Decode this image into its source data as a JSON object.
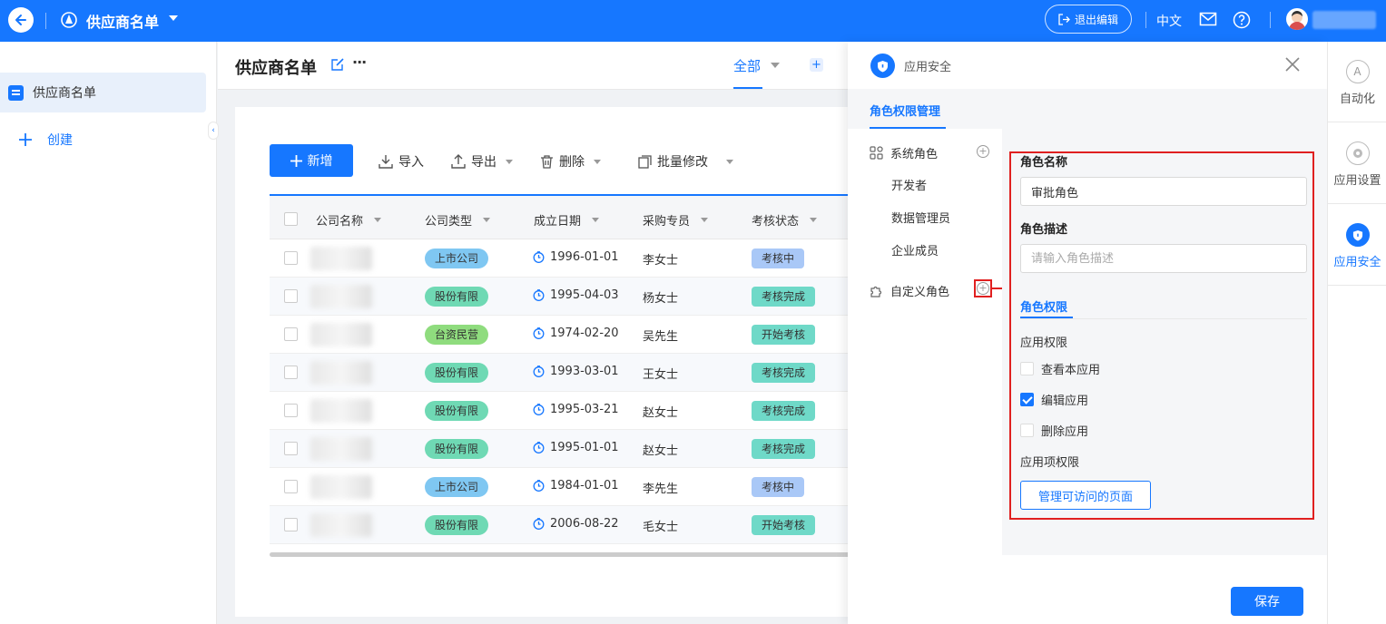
{
  "topbar": {
    "app_title": "供应商名单",
    "exit_edit": "退出编辑",
    "language": "中文"
  },
  "sidebar": {
    "items": [
      {
        "label": "供应商名单"
      }
    ],
    "create_label": "创建"
  },
  "main": {
    "page_title": "供应商名单",
    "view_tab": "全部",
    "toolbar": {
      "add": "新增",
      "import": "导入",
      "export": "导出",
      "delete": "删除",
      "batch_edit": "批量修改"
    },
    "table": {
      "columns": [
        "公司名称",
        "公司类型",
        "成立日期",
        "采购专员",
        "考核状态"
      ],
      "rows": [
        {
          "type": "上市公司",
          "date": "1996-01-01",
          "person": "李女士",
          "status": "考核中"
        },
        {
          "type": "股份有限",
          "date": "1995-04-03",
          "person": "杨女士",
          "status": "考核完成"
        },
        {
          "type": "台资民营",
          "date": "1974-02-20",
          "person": "吴先生",
          "status": "开始考核"
        },
        {
          "type": "股份有限",
          "date": "1993-03-01",
          "person": "王女士",
          "status": "考核完成"
        },
        {
          "type": "股份有限",
          "date": "1995-03-21",
          "person": "赵女士",
          "status": "考核完成"
        },
        {
          "type": "股份有限",
          "date": "1995-01-01",
          "person": "赵女士",
          "status": "考核完成"
        },
        {
          "type": "上市公司",
          "date": "1984-01-01",
          "person": "李先生",
          "status": "考核中"
        },
        {
          "type": "股份有限",
          "date": "2006-08-22",
          "person": "毛女士",
          "status": "开始考核"
        }
      ]
    }
  },
  "drawer": {
    "title": "应用安全",
    "tab": "角色权限管理",
    "system_roles_label": "系统角色",
    "system_roles": [
      "开发者",
      "数据管理员",
      "企业成员"
    ],
    "custom_roles_label": "自定义角色",
    "form": {
      "role_name_label": "角色名称",
      "role_name_value": "审批角色",
      "role_desc_label": "角色描述",
      "role_desc_placeholder": "请输入角色描述",
      "perm_tab": "角色权限",
      "app_perm_label": "应用权限",
      "perms": [
        {
          "label": "查看本应用",
          "checked": false
        },
        {
          "label": "编辑应用",
          "checked": true
        },
        {
          "label": "删除应用",
          "checked": false
        }
      ],
      "item_perm_label": "应用项权限",
      "manage_pages_button": "管理可访问的页面"
    },
    "save_button": "保存"
  },
  "rail": {
    "items": [
      {
        "label": "自动化"
      },
      {
        "label": "应用设置"
      },
      {
        "label": "应用安全"
      }
    ]
  },
  "colors": {
    "primary": "#1677ff",
    "highlight_red": "#e02020",
    "tag_blue": "#7fc7f2",
    "tag_green": "#6fd9b4",
    "tag_lime": "#8fdc7e",
    "status_blue": "#a9c8f7",
    "status_teal": "#6fd9c8"
  }
}
